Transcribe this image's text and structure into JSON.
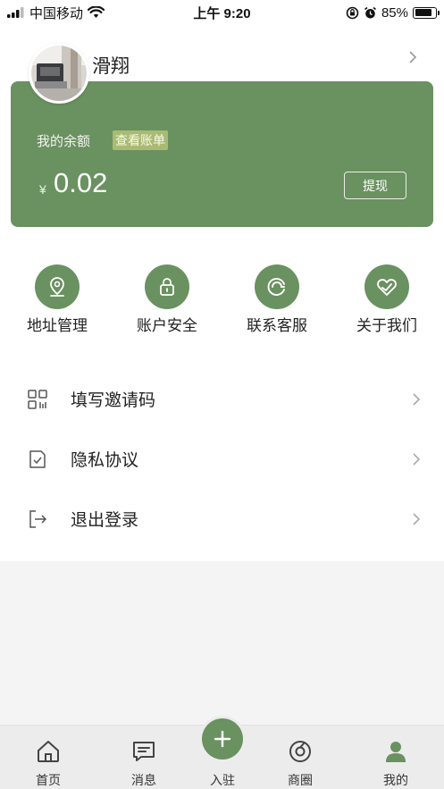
{
  "status_bar": {
    "carrier": "中国移动",
    "time": "上午 9:20",
    "battery": "85%",
    "battery_level": 0.85
  },
  "profile": {
    "name": "滑翔"
  },
  "balance_card": {
    "label": "我的余额",
    "bill_link": "查看账单",
    "currency": "¥",
    "amount": "0.02",
    "withdraw_label": "提现"
  },
  "quick_actions": [
    {
      "label": "地址管理",
      "icon": "location-pin-icon"
    },
    {
      "label": "账户安全",
      "icon": "lock-icon"
    },
    {
      "label": "联系客服",
      "icon": "customer-service-icon"
    },
    {
      "label": "关于我们",
      "icon": "heart-check-icon"
    }
  ],
  "menu": [
    {
      "label": "填写邀请码",
      "icon": "invite-code-icon"
    },
    {
      "label": "隐私协议",
      "icon": "privacy-doc-icon"
    },
    {
      "label": "退出登录",
      "icon": "logout-icon"
    }
  ],
  "tab_bar": {
    "tabs": [
      {
        "label": "首页",
        "icon": "home-icon"
      },
      {
        "label": "消息",
        "icon": "message-icon"
      },
      {
        "label": "入驻",
        "icon": "plus-icon"
      },
      {
        "label": "商圈",
        "icon": "business-circle-icon"
      },
      {
        "label": "我的",
        "icon": "user-icon"
      }
    ]
  },
  "colors": {
    "accent": "#6a9160",
    "bill_tag": "#a9bb72",
    "background": "#f4f4f5"
  }
}
